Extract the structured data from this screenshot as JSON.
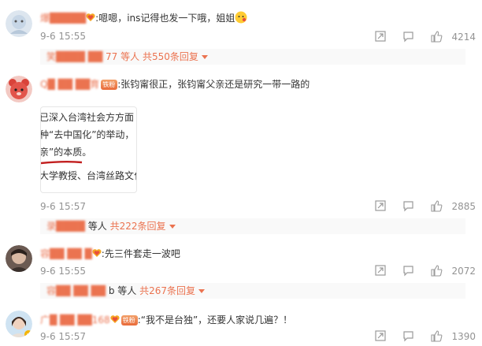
{
  "comments": [
    {
      "username": "爆…(pixelated)",
      "text": ":嗯嗯，ins记得也发一下哦，姐姐",
      "date": "9-6 15:55",
      "likes": "4214",
      "replies": {
        "names": "笑…(pixelated)",
        "suffix": "77 等人",
        "total": "共550条回复"
      }
    },
    {
      "username": "Q…(pixelated)",
      "badge": "铁粉",
      "text": ":张钧甯很正，张钧甯父亲还是研究一带一路的",
      "quote_lines": [
        "已深入台湾社会方方面",
        "种“去中国化”的举动，",
        "亲”的本质。",
        "大学教授、台湾丝路文化"
      ],
      "date": "9-6 15:57",
      "likes": "2885",
      "replies": {
        "names": "…(pixelated)",
        "suffix": "等人",
        "total": "共222条回复"
      }
    },
    {
      "username": "容…(pixelated)",
      "text": ":先三件套走一波吧",
      "date": "9-6 15:55",
      "likes": "2072",
      "replies": {
        "names": "容…(pixelated)",
        "suffix": "b 等人",
        "total": "共267条回复"
      }
    },
    {
      "username": "…(pixelated)",
      "badge": "铁粉",
      "text": ":“我不是台独”，还要人家说几遍？！",
      "date": "9-6 15:57",
      "likes": "1390"
    }
  ],
  "icons": [
    "share-icon",
    "comment-icon",
    "like-icon",
    "heart-badge-icon"
  ],
  "colors": {
    "accent": "#eb7350",
    "meta": "#939393"
  }
}
